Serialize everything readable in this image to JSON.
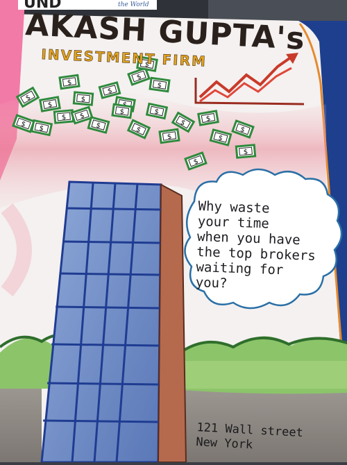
{
  "title": "AKASH GUPTA's",
  "subtitle": "INVESTMENT FIRM",
  "corner_text": "UND",
  "corner_small_text": "the World",
  "cloud_lines": [
    "Why waste",
    "your time",
    "when you have",
    "the top brokers",
    "waiting for",
    "you?"
  ],
  "address_lines": [
    "121 Wall street",
    "New York"
  ],
  "bill_symbol": "$",
  "colors": {
    "page": "#f4f1f0",
    "pink_spine": "#f27aa6",
    "blue_cover": "#1d3f8e",
    "money_green": "#2f8a3c",
    "chart_red": "#c83a2a",
    "building_blue": "#6f8fc8",
    "building_brown": "#b56a4e",
    "grass": "#8cc46a",
    "ground": "#8a8580",
    "cloud_outline": "#2a6fa6"
  }
}
